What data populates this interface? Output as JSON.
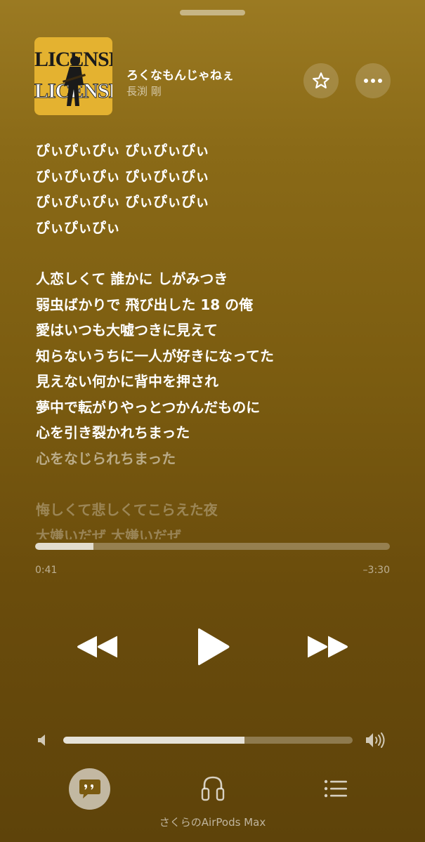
{
  "now_playing": {
    "album_art_text": "LICENSE",
    "title": "ろくなもんじゃねぇ",
    "artist": "長渕 剛"
  },
  "header_buttons": {
    "favorite_icon": "star-outline-icon",
    "more_icon": "ellipsis-icon"
  },
  "lyrics": {
    "stanza1": [
      "ぴぃぴぃぴぃ ぴぃぴぃぴぃ",
      "ぴぃぴぃぴぃ ぴぃぴぃぴぃ",
      "ぴぃぴぃぴぃ ぴぃぴぃぴぃ",
      "ぴぃぴぃぴぃ"
    ],
    "stanza2": [
      "人恋しくて 誰かに しがみつき",
      "弱虫ばかりで 飛び出した 18 の俺",
      "愛はいつも大嘘つきに見えて",
      "知らないうちに一人が好きになってた",
      "見えない何かに背中を押され",
      "夢中で転がりやっとつかんだものに",
      "心を引き裂かれちまった",
      "心をなじられちまった"
    ],
    "stanza3": [
      "悔しくて悲しくてこらえた夜",
      "大嫌いだぜ 大嫌いだぜ"
    ]
  },
  "playback": {
    "elapsed": "0:41",
    "remaining": "–3:30",
    "progress_fraction": 0.164,
    "volume_fraction": 0.625
  },
  "transport": {
    "rewind_icon": "backward-icon",
    "play_icon": "play-icon",
    "forward_icon": "forward-icon"
  },
  "bottom_bar": {
    "lyrics_icon": "quote-bubble-icon",
    "airplay_icon": "airpods-max-icon",
    "queue_icon": "list-icon",
    "device_label": "さくらのAirPods Max"
  },
  "colors": {
    "background_top": "#9b7a22",
    "background_bottom": "#5e430a",
    "album_yellow": "#e4b230"
  }
}
